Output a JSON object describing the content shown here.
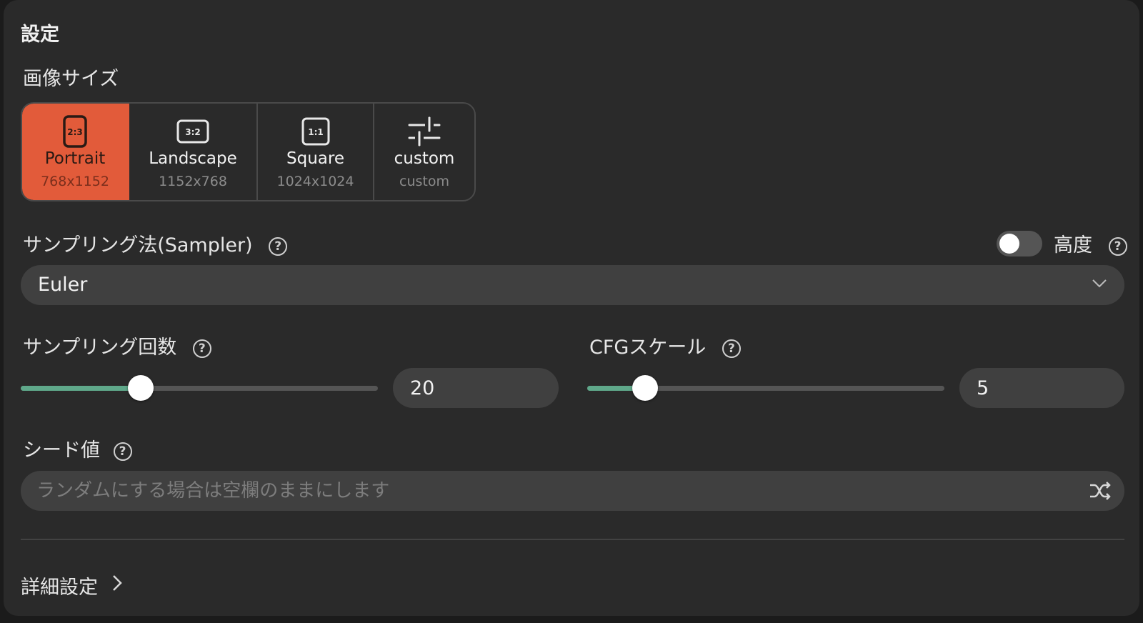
{
  "panel": {
    "title": "設定"
  },
  "image_size": {
    "label": "画像サイズ",
    "options": [
      {
        "name": "Portrait",
        "dims": "768x1152",
        "icon": "portrait-2-3-icon",
        "icon_text": "2:3",
        "active": true
      },
      {
        "name": "Landscape",
        "dims": "1152x768",
        "icon": "landscape-3-2-icon",
        "icon_text": "3:2",
        "active": false
      },
      {
        "name": "Square",
        "dims": "1024x1024",
        "icon": "square-1-1-icon",
        "icon_text": "1:1",
        "active": false
      },
      {
        "name": "custom",
        "dims": "custom",
        "icon": "sliders-icon",
        "active": false
      }
    ]
  },
  "sampler": {
    "label": "サンプリング法(Sampler)",
    "value": "Euler",
    "advanced_label": "高度",
    "advanced_enabled": false
  },
  "steps": {
    "label": "サンプリング回数",
    "value": "20",
    "level": 0.335
  },
  "cfg": {
    "label": "CFGスケール",
    "value": "5",
    "level": 0.163
  },
  "seed": {
    "label": "シード値",
    "placeholder": "ランダムにする場合は空欄のままにします"
  },
  "details": {
    "label": "詳細設定"
  },
  "colors": {
    "accent": "#e25b3a",
    "slider_fill": "#5fa88a",
    "panel_bg": "#2a2a2a",
    "control_bg": "#404040"
  }
}
